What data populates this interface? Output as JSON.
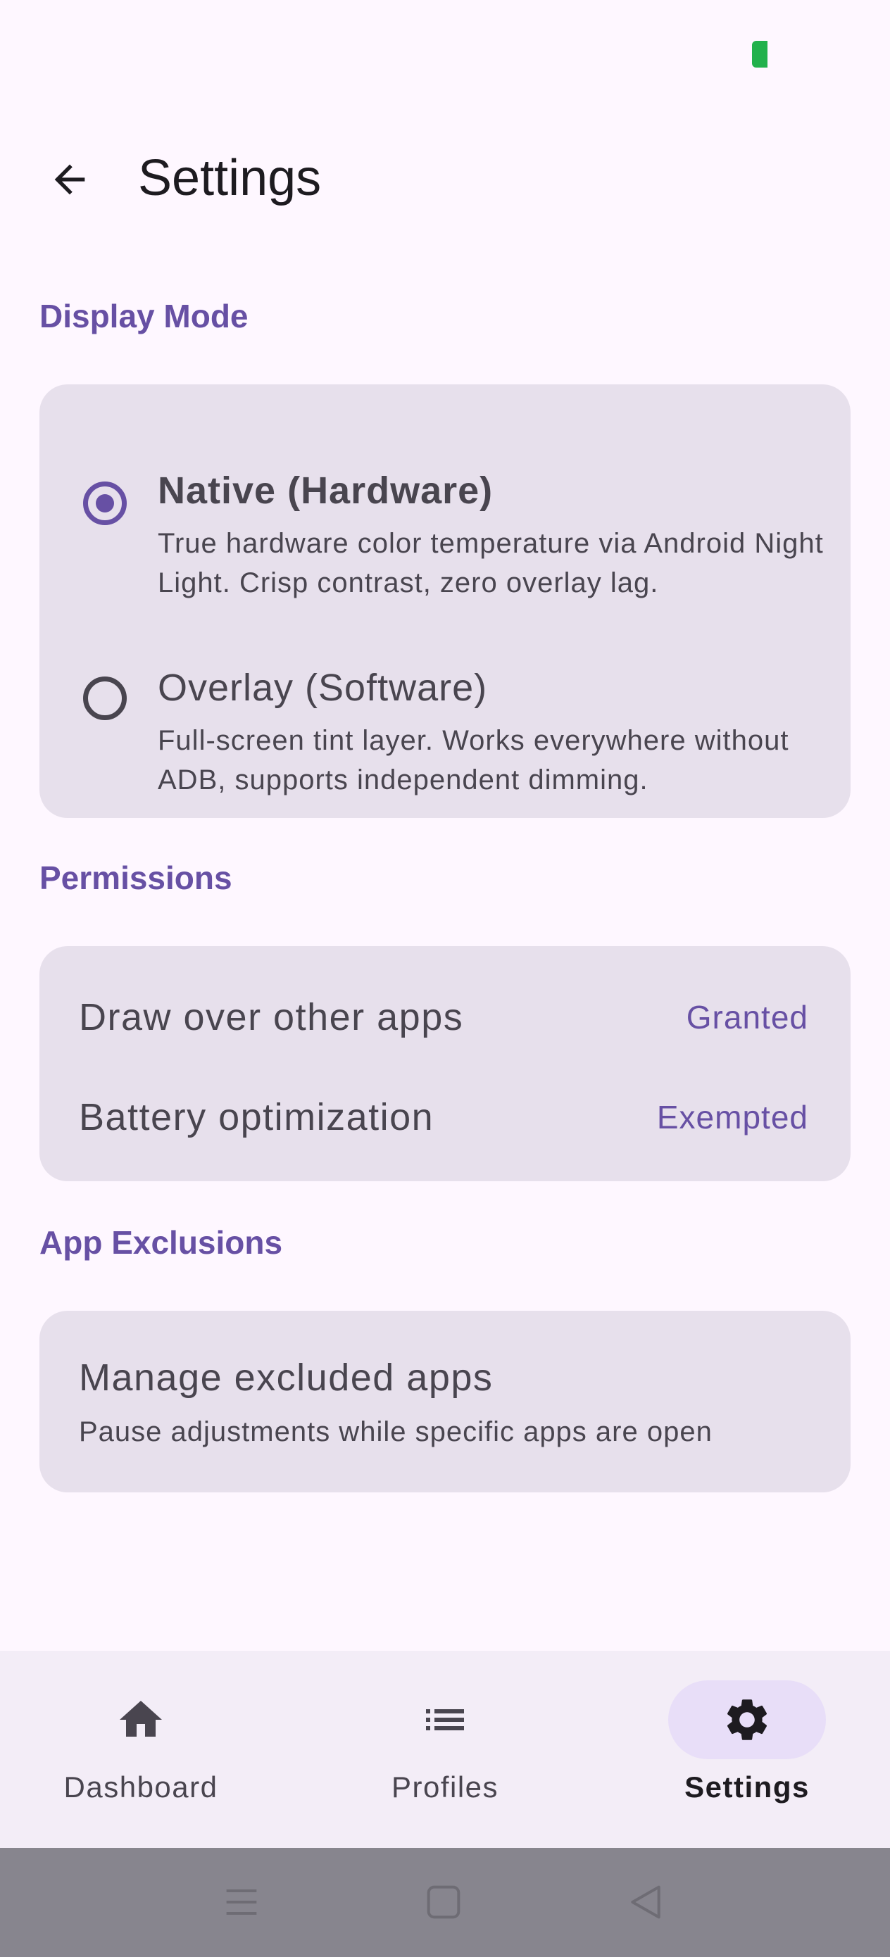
{
  "app_bar": {
    "title": "Settings"
  },
  "display_mode": {
    "header": "Display Mode",
    "options": [
      {
        "title": "Native (Hardware)",
        "description": "True hardware color temperature via Android Night Light. Crisp contrast, zero overlay lag.",
        "selected": true
      },
      {
        "title": "Overlay (Software)",
        "description": "Full-screen tint layer. Works everywhere without ADB, supports independent dimming.",
        "selected": false
      }
    ]
  },
  "permissions": {
    "header": "Permissions",
    "items": [
      {
        "label": "Draw over other apps",
        "value": "Granted"
      },
      {
        "label": "Battery optimization",
        "value": "Exempted"
      }
    ]
  },
  "app_exclusions": {
    "header": "App Exclusions",
    "title": "Manage excluded apps",
    "description": "Pause adjustments while specific apps are open"
  },
  "bottom_nav": {
    "items": [
      {
        "label": "Dashboard",
        "icon": "home-icon",
        "active": false
      },
      {
        "label": "Profiles",
        "icon": "list-icon",
        "active": false
      },
      {
        "label": "Settings",
        "icon": "gear-icon",
        "active": true
      }
    ]
  },
  "colors": {
    "accent": "#6750a4",
    "surface": "#e7e0ec",
    "background": "#fef7ff",
    "nav_indicator": "#e8def8",
    "battery": "#22b14c"
  }
}
